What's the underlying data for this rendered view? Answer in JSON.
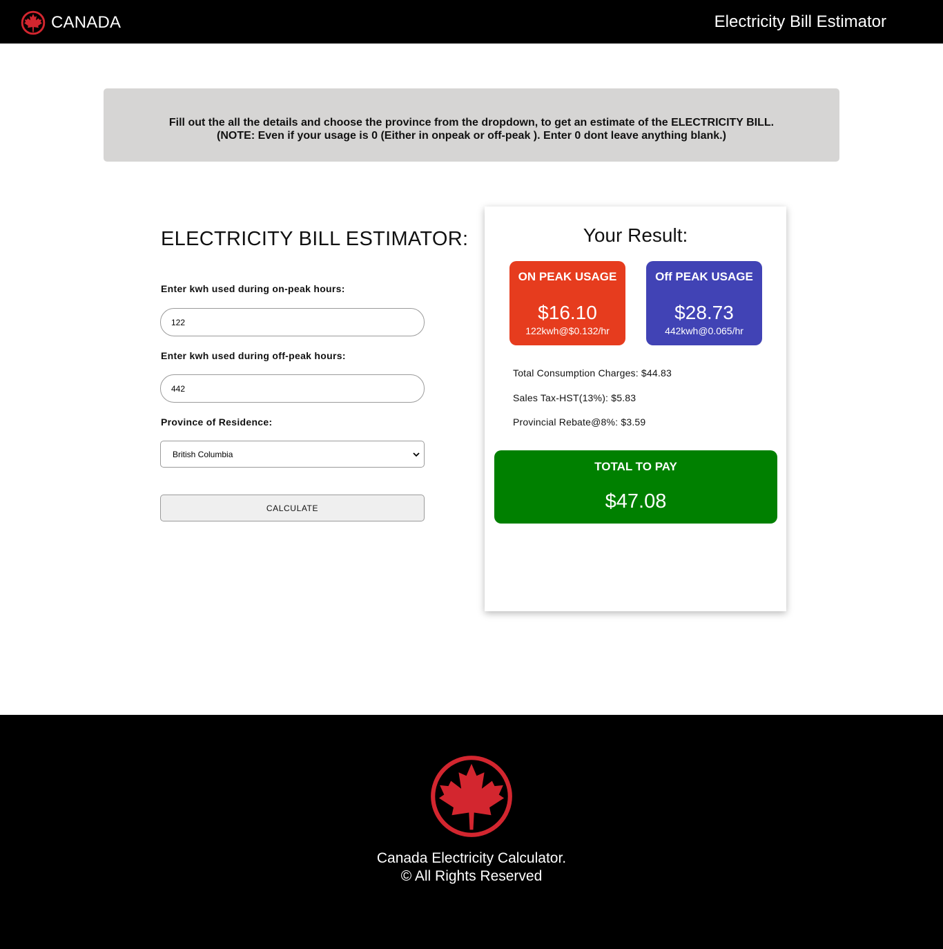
{
  "header": {
    "brand": "CANADA",
    "title": "Electricity Bill Estimator"
  },
  "notice": {
    "line1": "Fill out the all the details and choose the province from the dropdown, to get an estimate of the ELECTRICITY BILL.",
    "line2": "(NOTE: Even if your usage is 0 (Either in onpeak or off-peak ). Enter 0 dont leave anything blank.)"
  },
  "form": {
    "title": "ELECTRICITY BILL ESTIMATOR:",
    "onpeak_label": "Enter kwh used during on-peak hours:",
    "onpeak_value": "122",
    "offpeak_label": "Enter kwh used during off-peak hours:",
    "offpeak_value": "442",
    "province_label": "Province of Residence:",
    "province_value": "British Columbia",
    "calculate_label": "CALCULATE"
  },
  "result": {
    "title": "Your Result:",
    "on_peak": {
      "heading": "ON PEAK USAGE",
      "amount": "$16.10",
      "rate": "122kwh@$0.132/hr",
      "color": "#e63c1e"
    },
    "off_peak": {
      "heading": "Off PEAK USAGE",
      "amount": "$28.73",
      "rate": "442kwh@0.065/hr",
      "color": "#4143b5"
    },
    "total_consumption": "Total Consumption Charges: $44.83",
    "sales_tax": "Sales Tax-HST(13%): $5.83",
    "rebate": "Provincial Rebate@8%: $3.59",
    "total_heading": "TOTAL TO PAY",
    "total_amount": "$47.08",
    "total_color": "#008000"
  },
  "footer": {
    "line1": "Canada Electricity Calculator.",
    "line2": "© All Rights Reserved",
    "logo_icon": "maple-leaf-icon"
  }
}
